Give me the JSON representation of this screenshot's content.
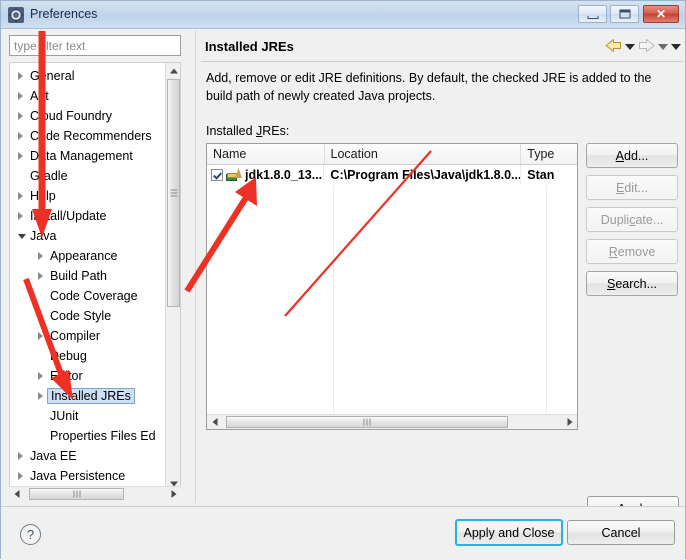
{
  "window": {
    "title": "Preferences",
    "app_icon": "preferences-gear-icon",
    "controls": {
      "minimize": "minimize-icon",
      "maximize": "maximize-icon",
      "close": "✕"
    }
  },
  "sidebar": {
    "filter": {
      "value": "",
      "placeholder": "type filter text"
    },
    "items": [
      {
        "label": "General",
        "level": 1,
        "twisty": "closed",
        "selected": false
      },
      {
        "label": "Ant",
        "level": 1,
        "twisty": "closed",
        "selected": false
      },
      {
        "label": "Cloud Foundry",
        "level": 1,
        "twisty": "closed",
        "selected": false
      },
      {
        "label": "Code Recommenders",
        "level": 1,
        "twisty": "closed",
        "selected": false
      },
      {
        "label": "Data Management",
        "level": 1,
        "twisty": "closed",
        "selected": false
      },
      {
        "label": "Gradle",
        "level": 1,
        "twisty": "none",
        "selected": false
      },
      {
        "label": "Help",
        "level": 1,
        "twisty": "closed",
        "selected": false
      },
      {
        "label": "Install/Update",
        "level": 1,
        "twisty": "closed",
        "selected": false
      },
      {
        "label": "Java",
        "level": 1,
        "twisty": "open",
        "selected": false
      },
      {
        "label": "Appearance",
        "level": 2,
        "twisty": "closed",
        "selected": false
      },
      {
        "label": "Build Path",
        "level": 2,
        "twisty": "closed",
        "selected": false
      },
      {
        "label": "Code Coverage",
        "level": 2,
        "twisty": "none",
        "selected": false
      },
      {
        "label": "Code Style",
        "level": 2,
        "twisty": "closed",
        "selected": false
      },
      {
        "label": "Compiler",
        "level": 2,
        "twisty": "closed",
        "selected": false
      },
      {
        "label": "Debug",
        "level": 2,
        "twisty": "none",
        "selected": false
      },
      {
        "label": "Editor",
        "level": 2,
        "twisty": "closed",
        "selected": false
      },
      {
        "label": "Installed JREs",
        "level": 2,
        "twisty": "closed",
        "selected": true
      },
      {
        "label": "JUnit",
        "level": 2,
        "twisty": "none",
        "selected": false
      },
      {
        "label": "Properties Files Ed",
        "level": 2,
        "twisty": "none",
        "selected": false
      },
      {
        "label": "Java EE",
        "level": 1,
        "twisty": "closed",
        "selected": false
      },
      {
        "label": "Java Persistence",
        "level": 1,
        "twisty": "closed",
        "selected": false
      }
    ]
  },
  "page": {
    "title": "Installed JREs",
    "description": "Add, remove or edit JRE definitions. By default, the checked JRE is added to the build path of newly created Java projects.",
    "table_label": "Installed JREs:",
    "nav": {
      "back_icon": "back-arrow-icon",
      "back_dropdown_icon": "chevron-down-icon",
      "forward_icon": "forward-arrow-icon",
      "forward_dropdown_icon": "chevron-down-icon",
      "menu_icon": "chevron-down-icon"
    }
  },
  "table": {
    "columns": [
      "Name",
      "Location",
      "Type"
    ],
    "rows": [
      {
        "checked": true,
        "icon": "jre-library-icon",
        "name": "jdk1.8.0_13...",
        "location": "C:\\Program Files\\Java\\jdk1.8.0...",
        "type": "Stan"
      }
    ]
  },
  "side_buttons": [
    {
      "label": "Add...",
      "accel": "A",
      "enabled": true
    },
    {
      "label": "Edit...",
      "accel": "E",
      "enabled": false
    },
    {
      "label": "Duplicate...",
      "accel": "c",
      "enabled": false
    },
    {
      "label": "Remove",
      "accel": "R",
      "enabled": false
    },
    {
      "label": "Search...",
      "accel": "S",
      "enabled": true
    }
  ],
  "apply_button": {
    "label": "Apply",
    "accel": "A"
  },
  "footer": {
    "help_icon": "question-mark-icon",
    "apply_and_close": "Apply and Close",
    "cancel": "Cancel"
  },
  "colors": {
    "titlebar": "#c5d7ea",
    "close_button": "#c83f30",
    "selection": "#cde0f5",
    "default_button_focus": "#23b4e0",
    "annotation_red": "#ee3124"
  },
  "annotations": [
    {
      "name": "arrow-to-java-node",
      "shape": "vertical-down-arrow"
    },
    {
      "name": "arrow-to-installed-jres",
      "shape": "diagonal-down-right-arrow"
    },
    {
      "name": "arrow-to-jre-table-row",
      "shape": "diagonal-up-right-arrow"
    }
  ]
}
